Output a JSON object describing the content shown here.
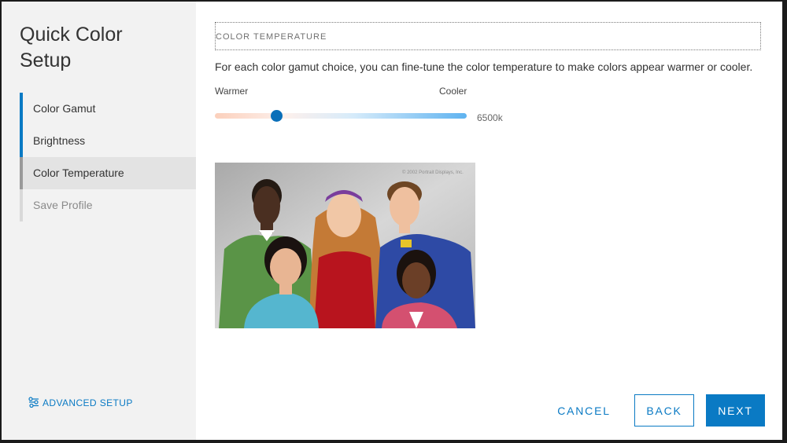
{
  "sidebar": {
    "title": "Quick Color Setup",
    "steps": [
      {
        "label": "Color Gamut"
      },
      {
        "label": "Brightness"
      },
      {
        "label": "Color Temperature"
      },
      {
        "label": "Save Profile"
      }
    ],
    "advanced_label": "ADVANCED SETUP"
  },
  "main": {
    "section_title": "COLOR TEMPERATURE",
    "description": "For each color gamut choice, you can fine-tune the color temperature to make colors appear warmer or cooler.",
    "slider": {
      "left_label": "Warmer",
      "right_label": "Cooler",
      "value_text": "6500k",
      "position_fraction": 0.245
    },
    "image_credit": "© 2002 Portrait Displays, Inc."
  },
  "buttons": {
    "cancel": "CANCEL",
    "back": "BACK",
    "next": "NEXT"
  },
  "colors": {
    "accent": "#0a7ac4",
    "sidebar_bg": "#f2f2f2",
    "current_step_bg": "#e3e3e3"
  },
  "icons": {
    "advanced": "settings-sliders-icon"
  }
}
